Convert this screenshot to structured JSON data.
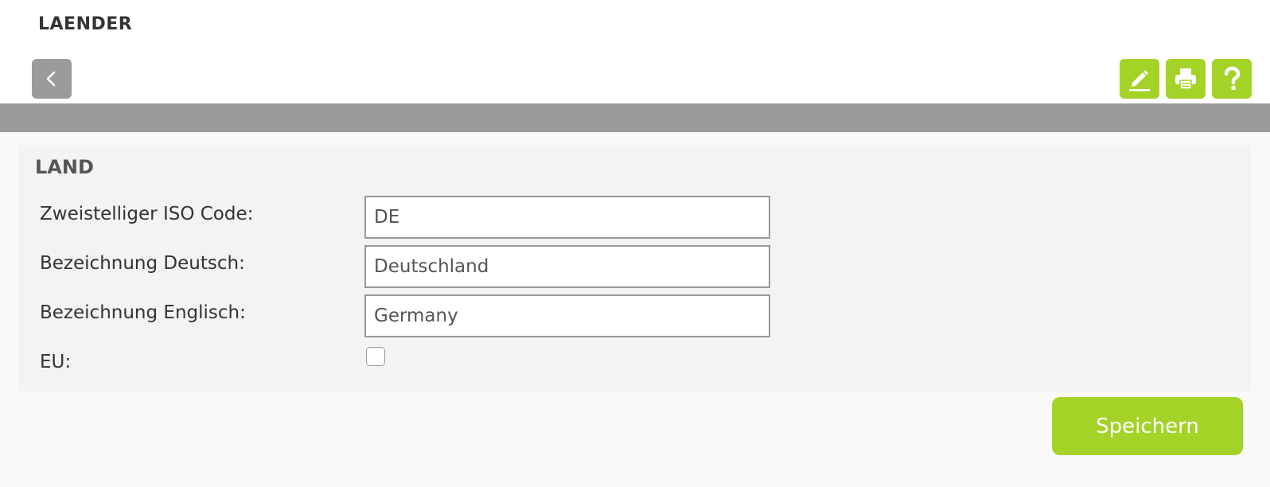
{
  "header": {
    "title": "LAENDER"
  },
  "toolbar": {
    "back_icon": "chevron-left-icon",
    "edit_icon": "pencil-icon",
    "print_icon": "printer-icon",
    "help_icon": "question-mark-icon"
  },
  "form": {
    "section_title": "LAND",
    "iso_label": "Zweistelliger ISO Code:",
    "iso_value": "DE",
    "de_label": "Bezeichnung Deutsch:",
    "de_value": "Deutschland",
    "en_label": "Bezeichnung Englisch:",
    "en_value": "Germany",
    "eu_label": "EU:",
    "eu_checked": false
  },
  "actions": {
    "save_label": "Speichern"
  },
  "colors": {
    "accent": "#a4d327",
    "gray_button": "#9b9b9b",
    "gray_bar": "#9b9b9b"
  }
}
